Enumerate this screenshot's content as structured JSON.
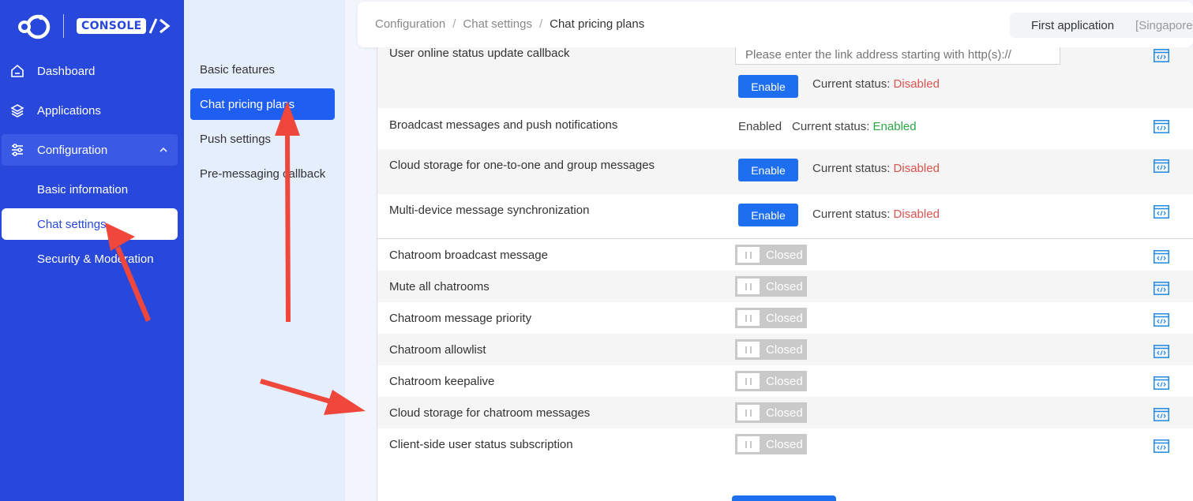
{
  "logo": {
    "badge_text": "CONSOLE"
  },
  "sidebar": {
    "items": [
      {
        "label": "Dashboard",
        "icon": "home-icon"
      },
      {
        "label": "Applications",
        "icon": "layers-icon"
      },
      {
        "label": "Configuration",
        "icon": "sliders-icon",
        "expanded": true
      }
    ],
    "sub_items": [
      {
        "label": "Basic information",
        "active": false
      },
      {
        "label": "Chat settings",
        "active": true
      },
      {
        "label": "Security & Moderation",
        "active": false
      }
    ]
  },
  "subnav": {
    "items": [
      {
        "label": "Basic features",
        "active": false
      },
      {
        "label": "Chat pricing plans",
        "active": true
      },
      {
        "label": "Push settings",
        "active": false
      },
      {
        "label": "Pre-messaging callback",
        "active": false
      }
    ]
  },
  "header": {
    "breadcrumb": [
      "Configuration",
      "Chat settings",
      "Chat pricing plans"
    ],
    "app_name": "First application",
    "region": "[Singapore]"
  },
  "features": {
    "status_prefix": "Current status:",
    "enable_label": "Enable",
    "disabled_value": "Disabled",
    "enabled_value": "Enabled",
    "closed_label": "Closed",
    "url_placeholder": "Please enter the link address starting with http(s)://",
    "online_status_callback": "User online status update callback",
    "broadcast_push": "Broadcast messages and push notifications",
    "broadcast_push_state": "Enabled",
    "cloud_storage_1v1_group": "Cloud storage for one-to-one and group messages",
    "multi_device_sync": "Multi-device message synchronization",
    "toggles": [
      "Chatroom broadcast message",
      "Mute all chatrooms",
      "Chatroom message priority",
      "Chatroom allowlist",
      "Chatroom keepalive",
      "Cloud storage for chatroom messages",
      "Client-side user status subscription"
    ]
  },
  "colors": {
    "sidebar_bg": "#2848dc",
    "accent_blue": "#1e6ef0",
    "disabled_red": "#d9534f",
    "enabled_green": "#28a745",
    "arrow_red": "#f0473c"
  }
}
